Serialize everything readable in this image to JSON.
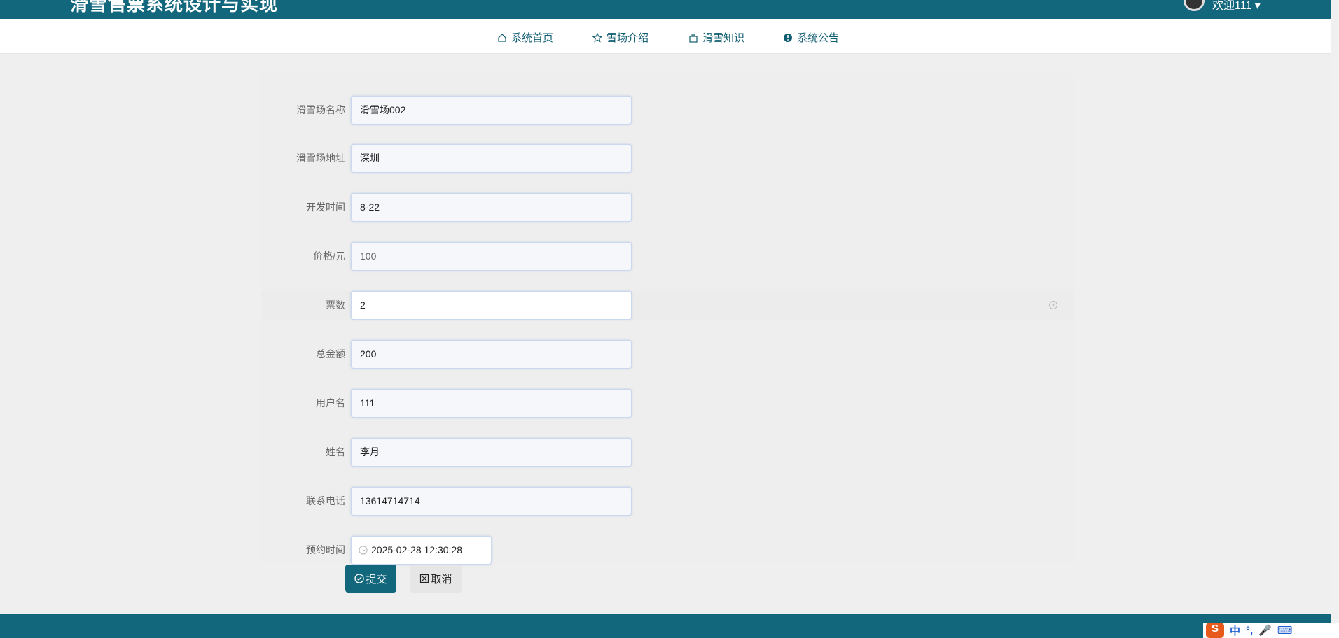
{
  "header": {
    "title": "滑雪售票系统设计与实现",
    "welcome": "欢迎111 ▾"
  },
  "nav": [
    {
      "label": "系统首页",
      "icon": "home-icon"
    },
    {
      "label": "雪场介绍",
      "icon": "star-icon"
    },
    {
      "label": "滑雪知识",
      "icon": "bag-icon"
    },
    {
      "label": "系统公告",
      "icon": "info-icon"
    }
  ],
  "form": {
    "fields": [
      {
        "label": "滑雪场名称",
        "value": "滑雪场002"
      },
      {
        "label": "滑雪场地址",
        "value": "深圳"
      },
      {
        "label": "开发时间",
        "value": "8-22"
      },
      {
        "label": "价格/元",
        "value": "100"
      },
      {
        "label": "票数",
        "value": "2"
      },
      {
        "label": "总金额",
        "value": "200"
      },
      {
        "label": "用户名",
        "value": "111"
      },
      {
        "label": "姓名",
        "value": "李月"
      },
      {
        "label": "联系电话",
        "value": "13614714714"
      },
      {
        "label": "预约时间",
        "value": "2025-02-28 12:30:28"
      }
    ],
    "submit": "提交",
    "cancel": "取消"
  },
  "ime": {
    "logo": "S",
    "mode": "中",
    "punct": "°,"
  },
  "colors": {
    "primary": "#12677d",
    "background": "#efefef"
  }
}
